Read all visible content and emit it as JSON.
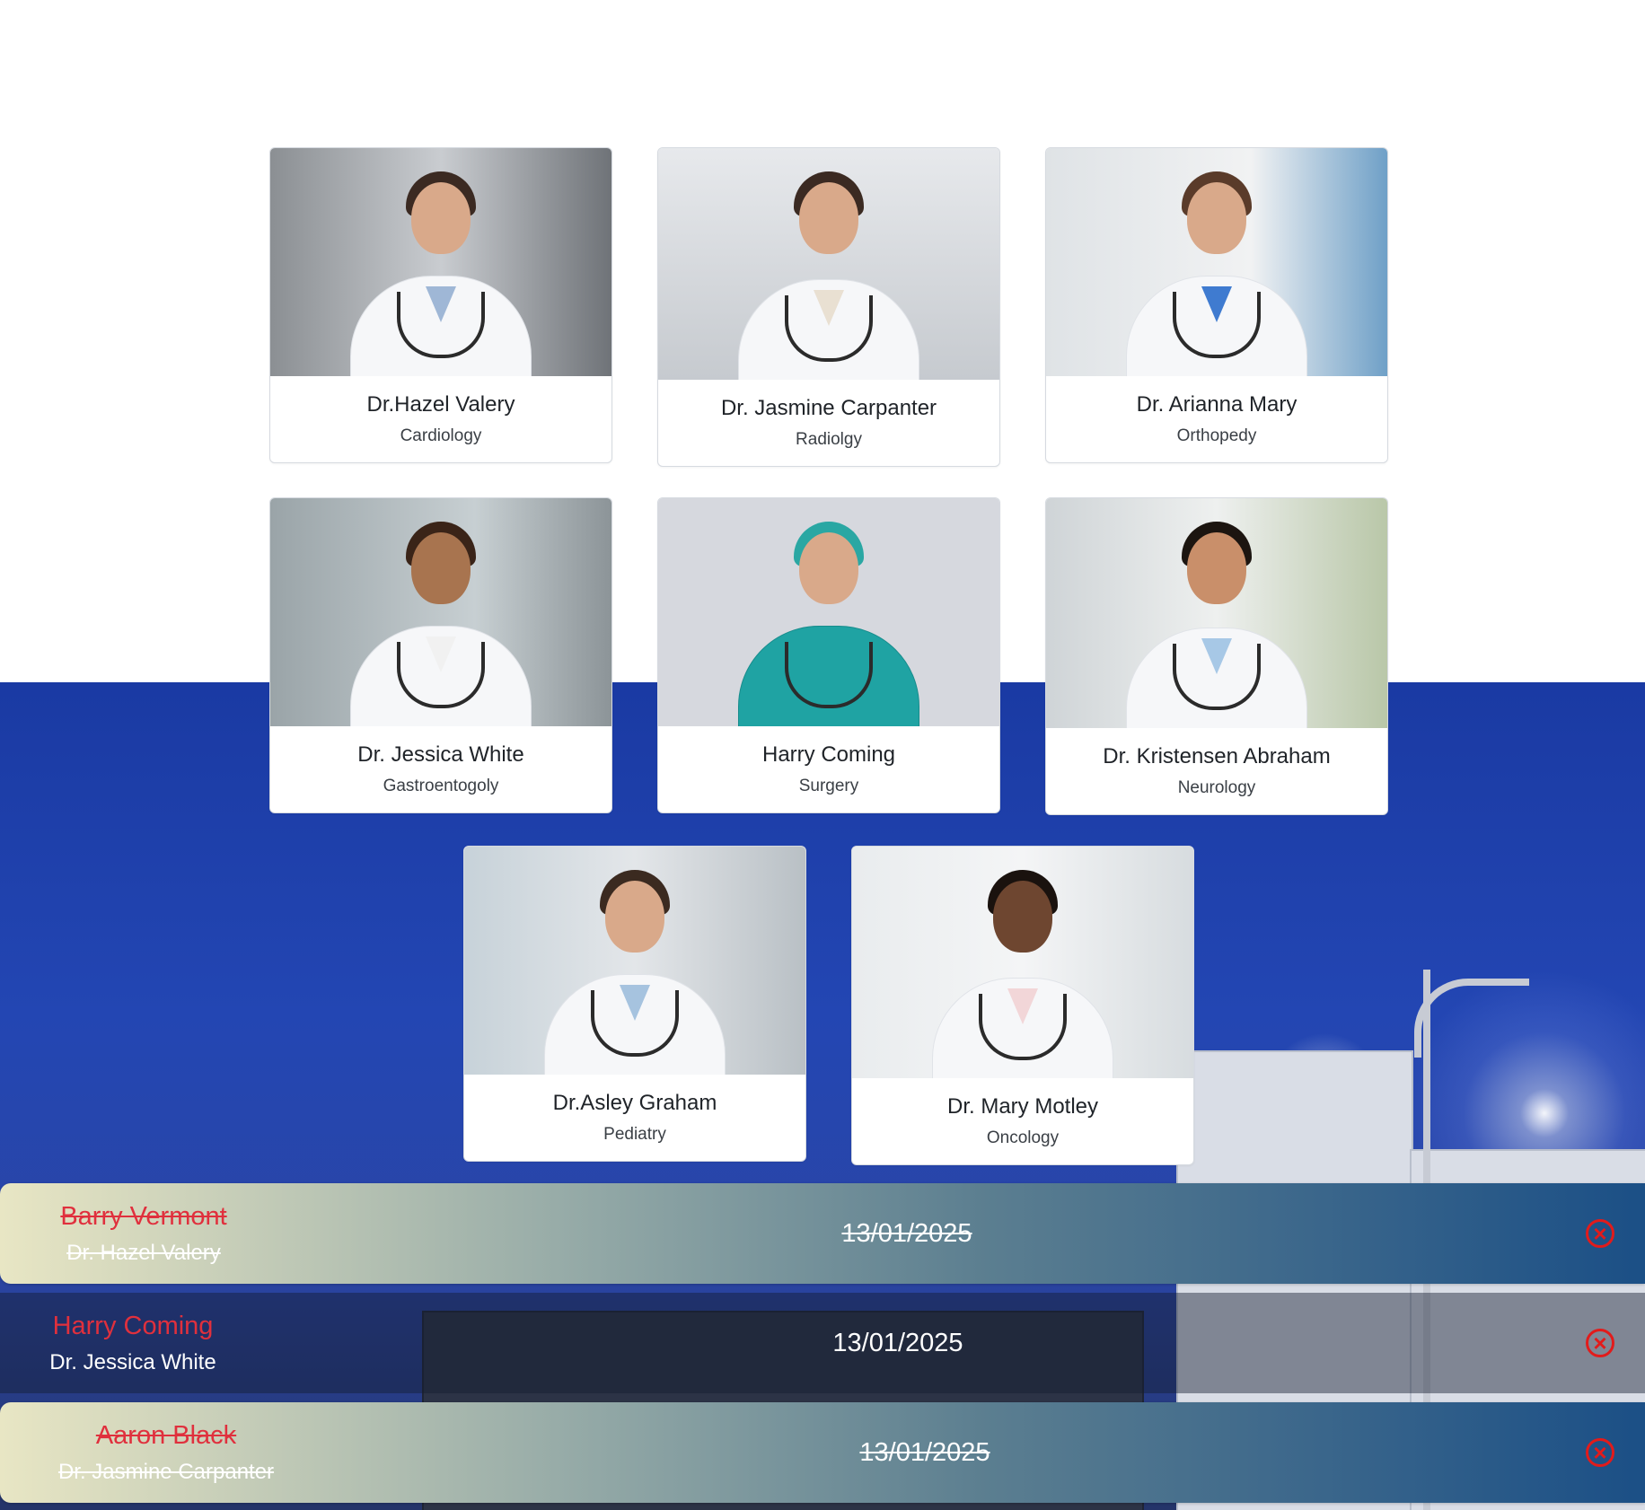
{
  "doctors": [
    {
      "name": "Dr.Hazel Valery",
      "specialty": "Cardiology"
    },
    {
      "name": "Dr. Jasmine Carpanter",
      "specialty": "Radiolgy"
    },
    {
      "name": "Dr. Arianna Mary",
      "specialty": "Orthopedy"
    },
    {
      "name": "Dr. Jessica White",
      "specialty": "Gastroentogoly"
    },
    {
      "name": "Harry Coming",
      "specialty": "Surgery"
    },
    {
      "name": "Dr. Kristensen Abraham",
      "specialty": "Neurology"
    },
    {
      "name": "Dr.Asley Graham",
      "specialty": "Pediatry"
    },
    {
      "name": "Dr. Mary Motley",
      "specialty": "Oncology"
    }
  ],
  "appointments": [
    {
      "patient": "Barry Vermont",
      "doctor": "Dr. Hazel Valery",
      "date": "13/01/2025",
      "cancelled": true
    },
    {
      "patient": "Harry Coming",
      "doctor": "Dr. Jessica White",
      "date": "13/01/2025",
      "cancelled": false
    },
    {
      "patient": "Aaron Black",
      "doctor": "Dr. Jasmine Carpanter",
      "date": "13/01/2025",
      "cancelled": true
    }
  ],
  "icons": {
    "cancel": "close-circle-icon"
  },
  "colors": {
    "cancel": "#e21b1b",
    "patient_name": "#e0303d",
    "scene_blue": "#2346b3"
  }
}
